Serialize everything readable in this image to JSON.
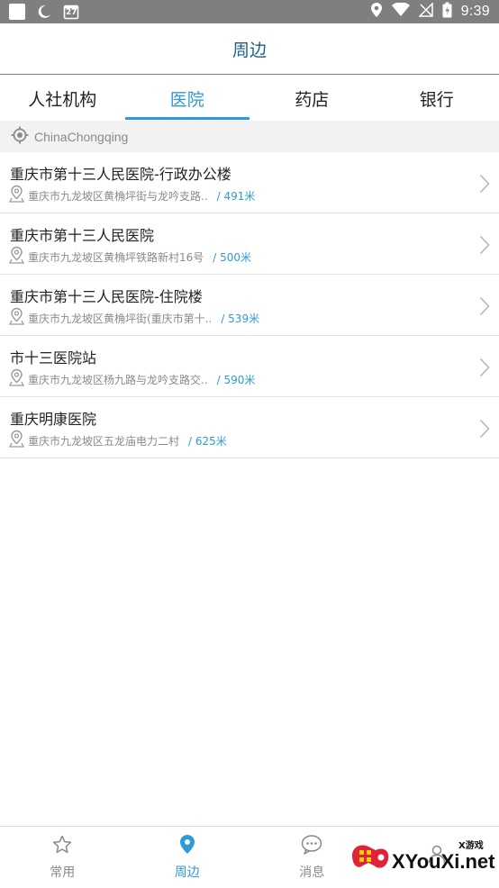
{
  "status_bar": {
    "time": "9:39",
    "calendar_day": "27"
  },
  "header": {
    "title": "周边"
  },
  "tabs": [
    {
      "label": "人社机构",
      "active": false
    },
    {
      "label": "医院",
      "active": true
    },
    {
      "label": "药店",
      "active": false
    },
    {
      "label": "银行",
      "active": false
    }
  ],
  "location": {
    "text": "ChinaChongqing"
  },
  "list": [
    {
      "title": "重庆市第十三人民医院-行政办公楼",
      "address": "重庆市九龙坡区黄桷坪街与龙吟支路..",
      "distance": "/ 491米"
    },
    {
      "title": "重庆市第十三人民医院",
      "address": "重庆市九龙坡区黄桷坪铁路新村16号",
      "distance": "/ 500米"
    },
    {
      "title": "重庆市第十三人民医院-住院楼",
      "address": "重庆市九龙坡区黄桷坪街(重庆市第十..",
      "distance": "/ 539米"
    },
    {
      "title": "市十三医院站",
      "address": "重庆市九龙坡区杨九路与龙吟支路交..",
      "distance": "/ 590米"
    },
    {
      "title": "重庆明康医院",
      "address": "重庆市九龙坡区五龙庙电力二村",
      "distance": "/ 625米"
    }
  ],
  "bottom_nav": [
    {
      "label": "常用",
      "icon": "star-icon",
      "active": false
    },
    {
      "label": "周边",
      "icon": "location-pin-icon",
      "active": true
    },
    {
      "label": "消息",
      "icon": "chat-bubble-icon",
      "active": false
    },
    {
      "label": "",
      "icon": "user-icon",
      "active": false
    }
  ],
  "watermark": {
    "brand": "XYouXi.net",
    "tag": "X游戏"
  },
  "colors": {
    "accent": "#2f9bd6",
    "title": "#1f5f86",
    "status_bar": "#7f7f7f"
  }
}
